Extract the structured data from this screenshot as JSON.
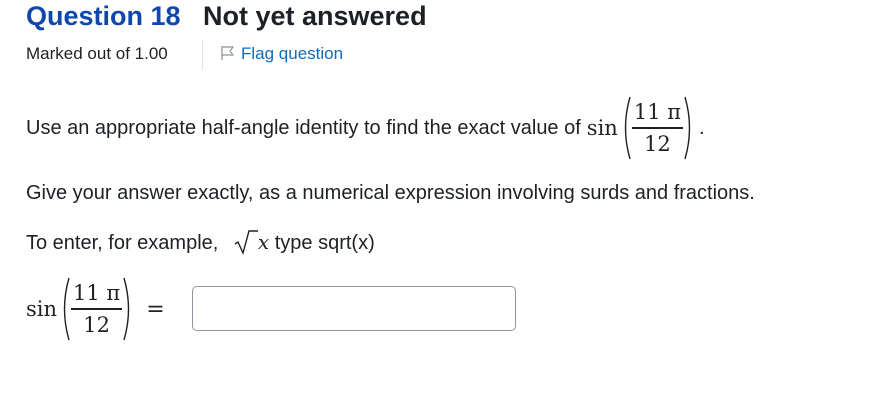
{
  "question": {
    "number_label": "Question 18",
    "state": "Not yet answered",
    "marked_out_of": "Marked out of 1.00",
    "flag_label": "Flag question"
  },
  "prompt": {
    "text": "Use an appropriate half-angle identity to find the exact value of",
    "func": "sin",
    "numerator": "11 π",
    "denominator": "12",
    "end": ".",
    "instruction": "Give your answer exactly, as a numerical expression involving surds and fractions.",
    "example_prefix": "To enter, for example,",
    "example_var": "x",
    "example_suffix": "type sqrt(x)"
  },
  "answer": {
    "func": "sin",
    "numerator": "11 π",
    "denominator": "12",
    "equals": "=",
    "value": ""
  },
  "colors": {
    "question_number": "#0f47ad",
    "link": "#0f6cbf",
    "text": "#1d2125",
    "input_border": "#8f959e"
  },
  "icons": {
    "flag": "flag-outline-icon",
    "sqrt": "square-root-symbol"
  }
}
